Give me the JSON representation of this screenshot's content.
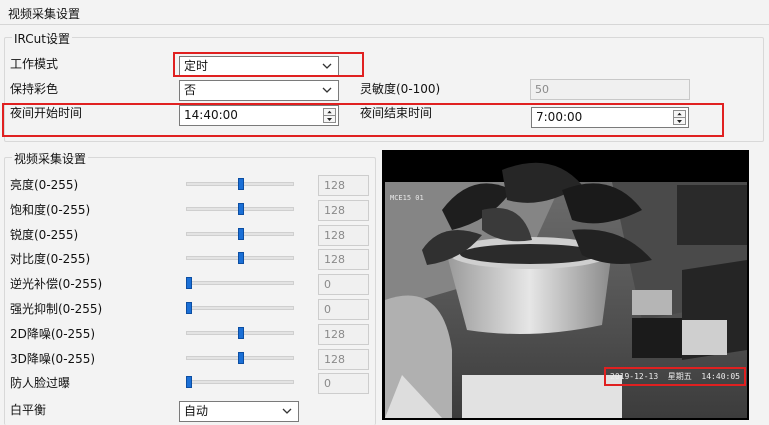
{
  "page": {
    "title": "视频采集设置"
  },
  "ircut": {
    "legend": "IRCut设置",
    "work_mode": {
      "label": "工作模式",
      "value": "定时"
    },
    "keep_color": {
      "label": "保持彩色",
      "value": "否"
    },
    "sensitivity": {
      "label": "灵敏度(0-100)",
      "value": "50"
    },
    "night_start": {
      "label": "夜间开始时间",
      "value": "14:40:00"
    },
    "night_end": {
      "label": "夜间结束时间",
      "value": "7:00:00"
    }
  },
  "capture": {
    "legend": "视频采集设置",
    "sliders": [
      {
        "label": "亮度(0-255)",
        "value": "128",
        "level": 0.5
      },
      {
        "label": "饱和度(0-255)",
        "value": "128",
        "level": 0.5
      },
      {
        "label": "锐度(0-255)",
        "value": "128",
        "level": 0.5
      },
      {
        "label": "对比度(0-255)",
        "value": "128",
        "level": 0.5
      },
      {
        "label": "逆光补偿(0-255)",
        "value": "0",
        "level": 0
      },
      {
        "label": "强光抑制(0-255)",
        "value": "0",
        "level": 0
      },
      {
        "label": "2D降噪(0-255)",
        "value": "128",
        "level": 0.5
      },
      {
        "label": "3D降噪(0-255)",
        "value": "128",
        "level": 0.5
      },
      {
        "label": "防人脸过曝",
        "value": "0",
        "level": 0
      }
    ],
    "white_balance": {
      "label": "白平衡",
      "value": "自动"
    }
  },
  "video": {
    "camera_label": "MCE15 01",
    "timestamp": "2019-12-13  星期五  14:40:05"
  },
  "colors": {
    "highlight": "#e02020",
    "slider_thumb": "#1a6fd6"
  },
  "icons": [
    "chevron-down-icon",
    "spin-up-icon",
    "spin-down-icon"
  ]
}
